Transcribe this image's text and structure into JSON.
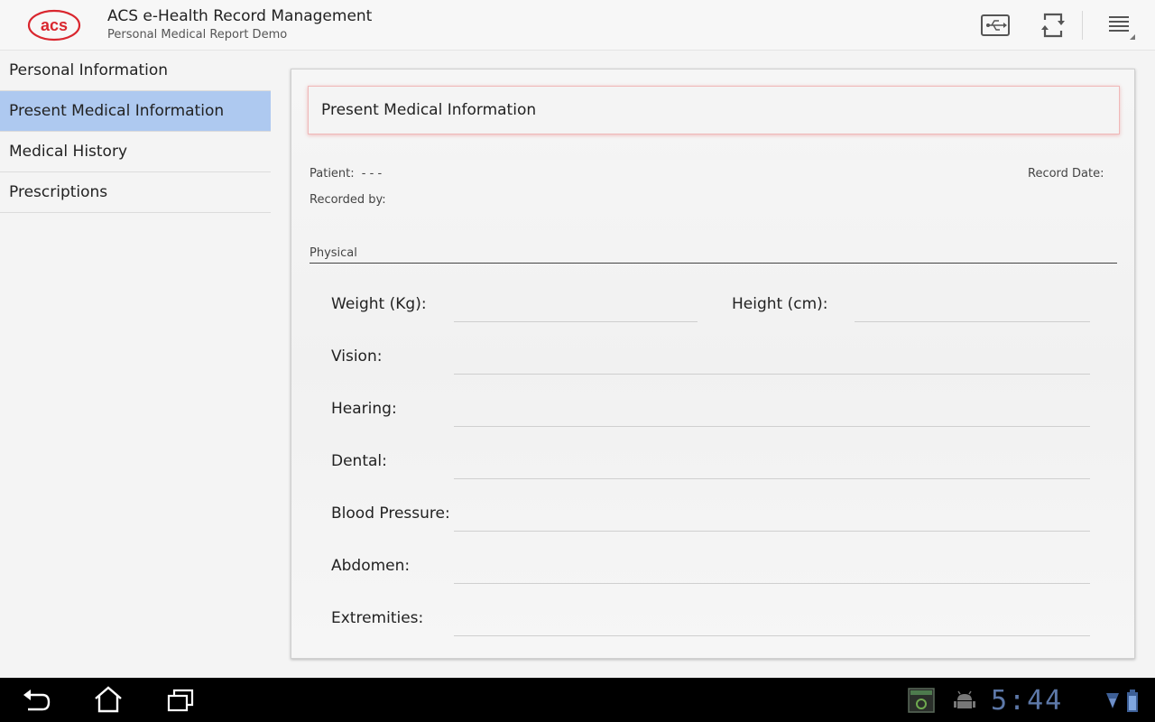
{
  "app": {
    "logo_text": "acs",
    "title": "ACS e-Health Record Management",
    "subtitle": "Personal Medical Report Demo"
  },
  "action_bar": {
    "icons": [
      "usb-icon",
      "sync-icon",
      "overflow-menu-icon"
    ]
  },
  "sidebar": {
    "items": [
      {
        "label": "Personal Information",
        "active": false
      },
      {
        "label": "Present Medical Information",
        "active": true
      },
      {
        "label": "Medical History",
        "active": false
      },
      {
        "label": "Prescriptions",
        "active": false
      }
    ]
  },
  "main": {
    "section_title": "Present Medical Information",
    "patient_label": "Patient:",
    "patient_value": "- - -",
    "record_date_label": "Record Date:",
    "recorded_by_label": "Recorded by:",
    "group_title": "Physical",
    "fields": {
      "weight": {
        "label": "Weight (Kg):",
        "value": ""
      },
      "height": {
        "label": "Height (cm):",
        "value": ""
      },
      "vision": {
        "label": "Vision:",
        "value": ""
      },
      "hearing": {
        "label": "Hearing:",
        "value": ""
      },
      "dental": {
        "label": "Dental:",
        "value": ""
      },
      "blood_pressure": {
        "label": "Blood Pressure:",
        "value": ""
      },
      "abdomen": {
        "label": "Abdomen:",
        "value": ""
      },
      "extremities": {
        "label": "Extremities:",
        "value": ""
      }
    }
  },
  "system_bar": {
    "clock": "5:44",
    "icons": [
      "back-icon",
      "home-icon",
      "recent-apps-icon",
      "screenshot-notification-icon",
      "debug-android-icon",
      "wifi-icon",
      "battery-icon"
    ]
  },
  "colors": {
    "active_nav": "#aec9f0",
    "logo_red": "#d9262e",
    "clock_blue": "#5d78a8"
  }
}
